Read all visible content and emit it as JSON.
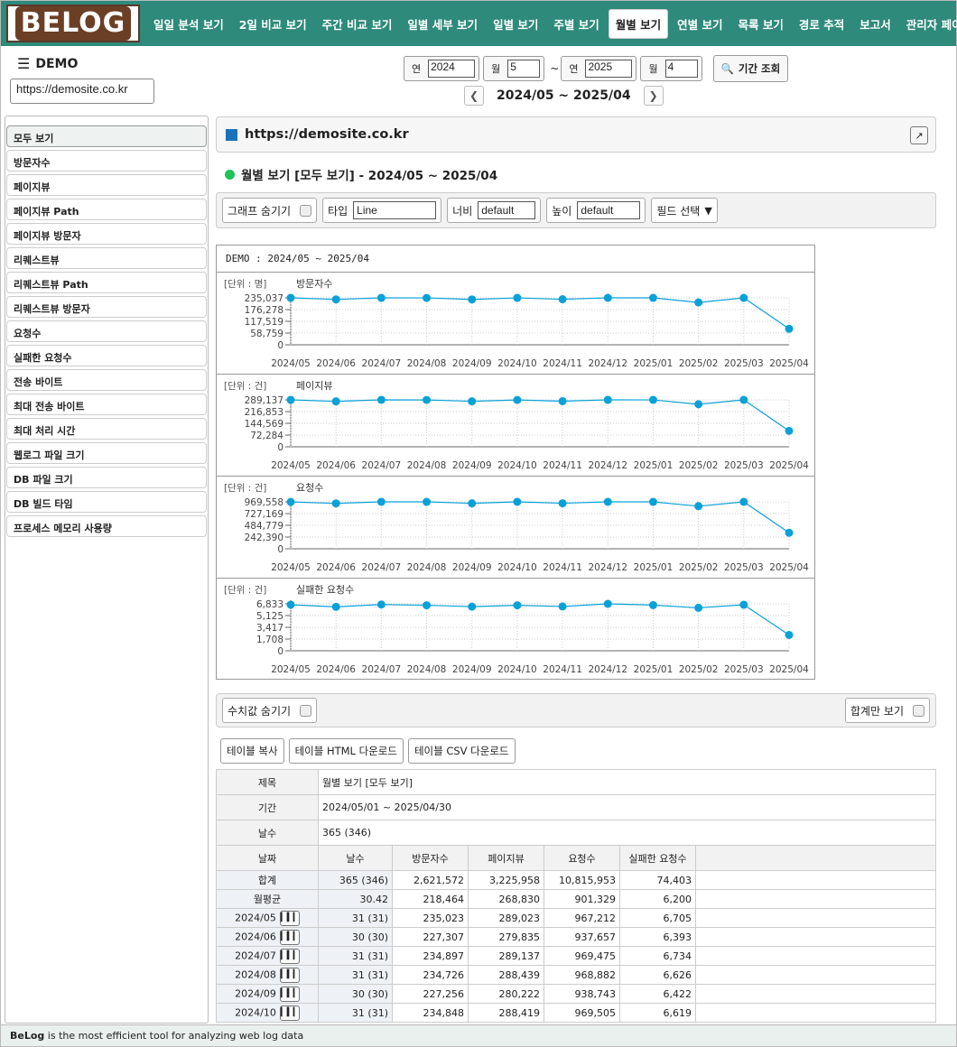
{
  "app": {
    "logo_text": "BELOG"
  },
  "nav": [
    "일일 분석 보기",
    "2일 비교 보기",
    "주간 비교 보기",
    "일별 세부 보기",
    "일별 보기",
    "주별 보기",
    "월별 보기",
    "연별 보기",
    "목록 보기",
    "경로 추적",
    "보고서",
    "관리자 페이지"
  ],
  "nav_active_index": 6,
  "site": {
    "menu_label": "DEMO",
    "url": "https://demosite.co.kr"
  },
  "period": {
    "year_label": "연",
    "month_label": "월",
    "start_year": "2024",
    "start_month": "5",
    "end_year": "2025",
    "end_month": "4",
    "sep": "~",
    "query_label": "기간 조회",
    "range": "2024/05 ~ 2025/04",
    "prev": "<",
    ".next": ">"
  },
  "sidebar": [
    "모두 보기",
    "방문자수",
    "페이지뷰",
    "페이지뷰 Path",
    "페이지뷰 방문자",
    "리퀘스트뷰",
    "리퀘스트뷰 Path",
    "리퀘스트뷰 방문자",
    "요청수",
    "실패한 요청수",
    "전송 바이트",
    "최대 전송 바이트",
    "최대 처리 시간",
    "웹로그 파일 크기",
    "DB 파일 크기",
    "DB 빌드 타임",
    "프로세스 메모리 사용량"
  ],
  "content": {
    "site_title": "https://demosite.co.kr",
    "view_title": "월별 보기 [모두 보기] - 2024/05 ~ 2025/04",
    "options": {
      "hide_graph": "그래프 숨기기",
      "type_label": "타입",
      "type_value": "Line",
      "width_label": "너비",
      "width_value": "default",
      "height_label": "높이",
      "height_value": "default",
      "field_select": "필드 선택"
    },
    "chart_header": "DEMO : 2024/05 ~ 2025/04",
    "hide_values": "수치값 숨기기",
    "total_only": "합계만 보기",
    "table_buttons": [
      "테이블 복사",
      "테이블 HTML 다운로드",
      "테이블 CSV 다운로드"
    ],
    "meta": [
      {
        "k": "제목",
        "v": "월별 보기 [모두 보기]"
      },
      {
        "k": "기간",
        "v": "2024/05/01 ~ 2025/04/30"
      },
      {
        "k": "날수",
        "v": "365 (346)"
      }
    ],
    "columns": [
      "날짜",
      "날수",
      "방문자수",
      "페이지뷰",
      "요청수",
      "실패한 요청수"
    ],
    "rows": [
      [
        "합계",
        "365 (346)",
        "2,621,572",
        "3,225,958",
        "10,815,953",
        "74,403"
      ],
      [
        "월평균",
        "30.42",
        "218,464",
        "268,830",
        "901,329",
        "6,200"
      ],
      [
        "2024/05",
        "31 (31)",
        "235,023",
        "289,023",
        "967,212",
        "6,705"
      ],
      [
        "2024/06",
        "30 (30)",
        "227,307",
        "279,835",
        "937,657",
        "6,393"
      ],
      [
        "2024/07",
        "31 (31)",
        "234,897",
        "289,137",
        "969,475",
        "6,734"
      ],
      [
        "2024/08",
        "31 (31)",
        "234,726",
        "288,439",
        "968,882",
        "6,626"
      ],
      [
        "2024/09",
        "30 (30)",
        "227,256",
        "280,222",
        "938,743",
        "6,422"
      ],
      [
        "2024/10",
        "31 (31)",
        "234,848",
        "288,419",
        "969,505",
        "6,619"
      ]
    ]
  },
  "footer": {
    "brand": "BeLog",
    "text": " is the most efficient tool for analyzing web log data"
  },
  "chart_data": [
    {
      "type": "line",
      "title": "방문자수",
      "unit": "[단위 : 명]",
      "categories": [
        "2024/05",
        "2024/06",
        "2024/07",
        "2024/08",
        "2024/09",
        "2024/10",
        "2024/11",
        "2024/12",
        "2025/01",
        "2025/02",
        "2025/03",
        "2025/04"
      ],
      "values": [
        235023,
        227307,
        234897,
        234726,
        227256,
        234848,
        228000,
        235037,
        234900,
        212000,
        235000,
        80000
      ],
      "ylim": [
        0,
        235037
      ],
      "ticks": [
        "235,037",
        "176,278",
        "117,519",
        "58,759",
        "0"
      ],
      "color": "#0aa0d8"
    },
    {
      "type": "line",
      "title": "페이지뷰",
      "unit": "[단위 : 건]",
      "categories": [
        "2024/05",
        "2024/06",
        "2024/07",
        "2024/08",
        "2024/09",
        "2024/10",
        "2024/11",
        "2024/12",
        "2025/01",
        "2025/02",
        "2025/03",
        "2025/04"
      ],
      "values": [
        289023,
        279835,
        289137,
        288439,
        280222,
        288419,
        281000,
        289000,
        288900,
        262000,
        289000,
        98000
      ],
      "ylim": [
        0,
        289137
      ],
      "ticks": [
        "289,137",
        "216,853",
        "144,569",
        "72,284",
        "0"
      ],
      "color": "#0aa0d8"
    },
    {
      "type": "line",
      "title": "요청수",
      "unit": "[단위 : 건]",
      "categories": [
        "2024/05",
        "2024/06",
        "2024/07",
        "2024/08",
        "2024/09",
        "2024/10",
        "2024/11",
        "2024/12",
        "2025/01",
        "2025/02",
        "2025/03",
        "2025/04"
      ],
      "values": [
        967212,
        937657,
        969475,
        968882,
        938743,
        969505,
        940000,
        969558,
        969000,
        880000,
        969000,
        330000
      ],
      "ylim": [
        0,
        969558
      ],
      "ticks": [
        "969,558",
        "727,169",
        "484,779",
        "242,390",
        "0"
      ],
      "color": "#0aa0d8"
    },
    {
      "type": "line",
      "title": "실패한 요청수",
      "unit": "[단위 : 건]",
      "categories": [
        "2024/05",
        "2024/06",
        "2024/07",
        "2024/08",
        "2024/09",
        "2024/10",
        "2024/11",
        "2024/12",
        "2025/01",
        "2025/02",
        "2025/03",
        "2025/04"
      ],
      "values": [
        6705,
        6393,
        6734,
        6626,
        6422,
        6619,
        6450,
        6833,
        6650,
        6250,
        6700,
        2300
      ],
      "ylim": [
        0,
        6833
      ],
      "ticks": [
        "6,833",
        "5,125",
        "3,417",
        "1,708",
        "0"
      ],
      "color": "#0aa0d8"
    }
  ]
}
